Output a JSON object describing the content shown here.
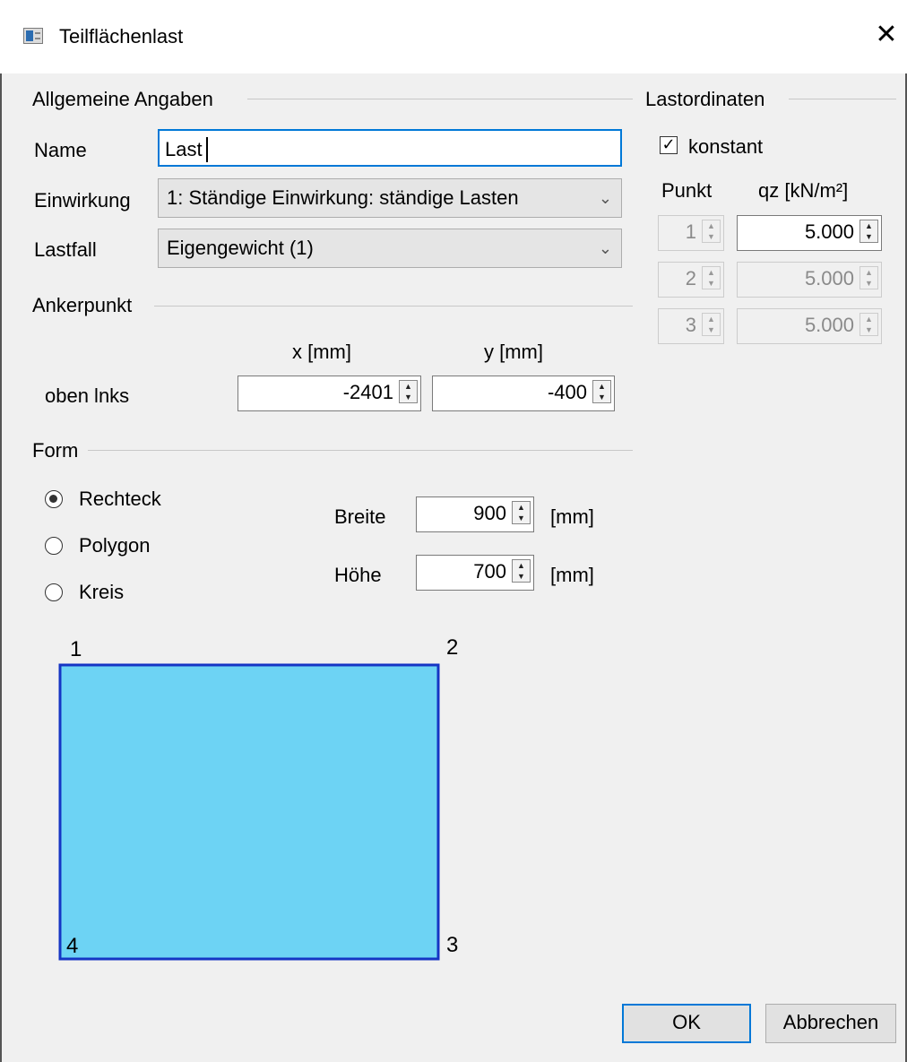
{
  "window": {
    "title": "Teilflächenlast",
    "close_glyph": "✕",
    "icon": "app-window-icon"
  },
  "allgemein": {
    "title": "Allgemeine Angaben",
    "name_label": "Name",
    "name_value": "Last",
    "einwirkung_label": "Einwirkung",
    "einwirkung_value": "1: Ständige Einwirkung: ständige Lasten",
    "lastfall_label": "Lastfall",
    "lastfall_value": "Eigengewicht (1)"
  },
  "ankerpunkt": {
    "title": "Ankerpunkt",
    "x_header": "x [mm]",
    "y_header": "y [mm]",
    "row_label": "oben lnks",
    "x_value": "-2401",
    "y_value": "-400"
  },
  "form": {
    "title": "Form",
    "options": [
      "Rechteck",
      "Polygon",
      "Kreis"
    ],
    "selected": "Rechteck",
    "breite_label": "Breite",
    "breite_value": "900",
    "hoehe_label": "Höhe",
    "hoehe_value": "700",
    "unit": "[mm]"
  },
  "preview": {
    "corners": [
      "1",
      "2",
      "3",
      "4"
    ],
    "fill_color": "#6dd3f4",
    "stroke_color": "#1535c4"
  },
  "lastordinaten": {
    "title": "Lastordinaten",
    "konstant_label": "konstant",
    "konstant_checked": true,
    "col_punkt": "Punkt",
    "col_qz": "qz [kN/m²]",
    "rows": [
      {
        "punkt": "1",
        "qz": "5.000",
        "enabled": true
      },
      {
        "punkt": "2",
        "qz": "5.000",
        "enabled": false
      },
      {
        "punkt": "3",
        "qz": "5.000",
        "enabled": false
      }
    ]
  },
  "buttons": {
    "ok": "OK",
    "cancel": "Abbrechen"
  },
  "colors": {
    "accent": "#0078d7",
    "dialog_bg": "#f0f0f0"
  }
}
